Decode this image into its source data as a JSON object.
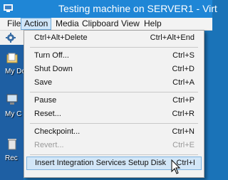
{
  "window": {
    "title": "Testing machine on SERVER1 - Virt"
  },
  "menubar": {
    "items": [
      "File",
      "Action",
      "Media",
      "Clipboard",
      "View",
      "Help"
    ],
    "active": "Action"
  },
  "desktop": {
    "icons": [
      {
        "label": "My Do",
        "icon": "documents-icon"
      },
      {
        "label": "My C",
        "icon": "computer-icon"
      },
      {
        "label": "Rec",
        "icon": "recycle-bin-icon"
      }
    ]
  },
  "action_menu": {
    "items": [
      {
        "label": "Ctrl+Alt+Delete",
        "shortcut": "Ctrl+Alt+End",
        "enabled": true
      },
      {
        "label": "Turn Off...",
        "shortcut": "Ctrl+S",
        "enabled": true
      },
      {
        "label": "Shut Down",
        "shortcut": "Ctrl+D",
        "enabled": true
      },
      {
        "label": "Save",
        "shortcut": "Ctrl+A",
        "enabled": true
      },
      {
        "label": "Pause",
        "shortcut": "Ctrl+P",
        "enabled": true
      },
      {
        "label": "Reset...",
        "shortcut": "Ctrl+R",
        "enabled": true
      },
      {
        "label": "Checkpoint...",
        "shortcut": "Ctrl+N",
        "enabled": true
      },
      {
        "label": "Revert...",
        "shortcut": "Ctrl+E",
        "enabled": false
      },
      {
        "label": "Insert Integration Services Setup Disk",
        "shortcut": "Ctrl+I",
        "enabled": true,
        "highlighted": true
      }
    ]
  }
}
